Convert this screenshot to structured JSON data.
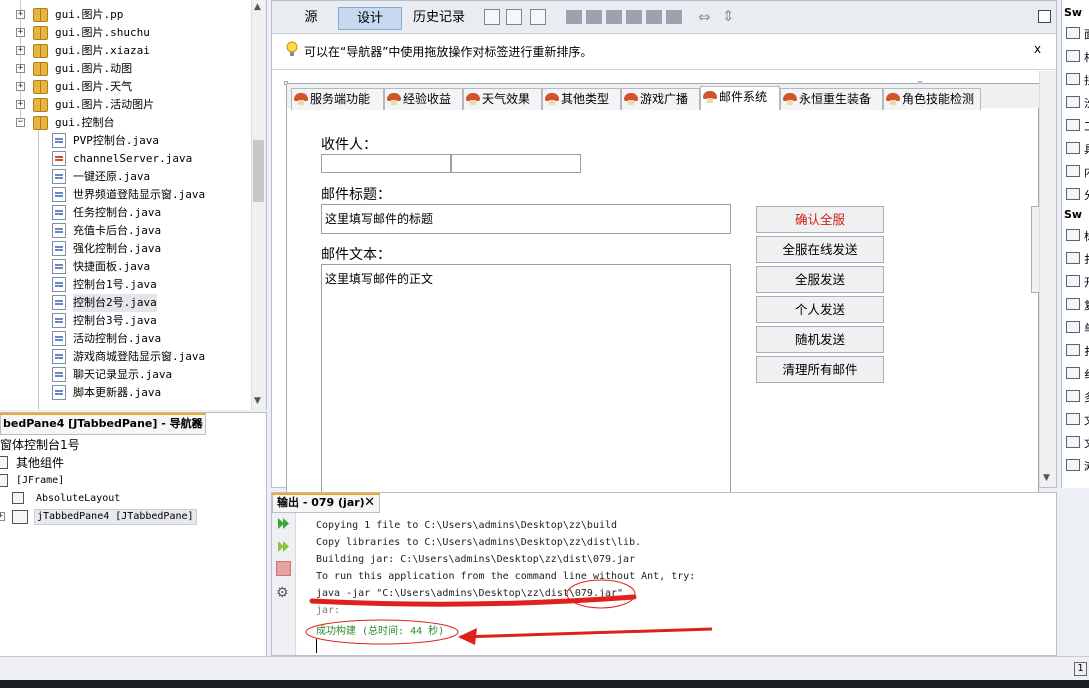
{
  "project_tree": {
    "items": [
      {
        "label": "gui.图片.pp",
        "kind": "package"
      },
      {
        "label": "gui.图片.shuchu",
        "kind": "package"
      },
      {
        "label": "gui.图片.xiazai",
        "kind": "package"
      },
      {
        "label": "gui.图片.动图",
        "kind": "package"
      },
      {
        "label": "gui.图片.天气",
        "kind": "package"
      },
      {
        "label": "gui.图片.活动图片",
        "kind": "package"
      },
      {
        "label": "gui.控制台",
        "kind": "package-open"
      },
      {
        "label": "PVP控制台.java",
        "kind": "java"
      },
      {
        "label": "channelServer.java",
        "kind": "java-red"
      },
      {
        "label": "一键还原.java",
        "kind": "java"
      },
      {
        "label": "世界频道登陆显示窗.java",
        "kind": "java"
      },
      {
        "label": "任务控制台.java",
        "kind": "java"
      },
      {
        "label": "充值卡后台.java",
        "kind": "java"
      },
      {
        "label": "强化控制台.java",
        "kind": "java"
      },
      {
        "label": "快捷面板.java",
        "kind": "java"
      },
      {
        "label": "控制台1号.java",
        "kind": "java"
      },
      {
        "label": "控制台2号.java",
        "kind": "java-selected"
      },
      {
        "label": "控制台3号.java",
        "kind": "java"
      },
      {
        "label": "活动控制台.java",
        "kind": "java"
      },
      {
        "label": "游戏商城登陆显示窗.java",
        "kind": "java"
      },
      {
        "label": "聊天记录显示.java",
        "kind": "java"
      },
      {
        "label": "脚本更新器.java",
        "kind": "java"
      }
    ]
  },
  "navigator": {
    "tab_label": "bedPane4 [JTabbedPane] - 导航器",
    "tab_close": "✕",
    "items": [
      {
        "label": "窗体控制台1号"
      },
      {
        "label": "其他组件"
      },
      {
        "label": "[JFrame]"
      },
      {
        "label": "AbsoluteLayout"
      },
      {
        "label": "jTabbedPane4 [JTabbedPane]"
      }
    ]
  },
  "editor": {
    "view_tabs": [
      "源",
      "设计",
      "历史记录"
    ],
    "active_view": "设计",
    "hint_text": "可以在“导航器”中使用拖放操作对标签进行重新排序。",
    "hint_close": "x",
    "tabs": [
      "服务端功能",
      "经验收益",
      "天气效果",
      "其他类型",
      "游戏广播",
      "邮件系统",
      "永恒重生装备",
      "角色技能检测"
    ],
    "active_tab": "邮件系统",
    "form": {
      "recipient_label": "收件人：",
      "title_label": "邮件标题：",
      "title_value": "这里填写邮件的标题",
      "body_label": "邮件文本：",
      "body_value": "这里填写邮件的正文"
    },
    "buttons": [
      {
        "label": "确认全服",
        "color": "#d0201a"
      },
      {
        "label": "全服在线发送",
        "color": "#000000"
      },
      {
        "label": "全服发送",
        "color": "#000000"
      },
      {
        "label": "个人发送",
        "color": "#000000"
      },
      {
        "label": "随机发送",
        "color": "#000000"
      },
      {
        "label": "清理所有邮件",
        "color": "#000000"
      }
    ]
  },
  "output": {
    "tab_label": "输出 - 079 (jar)",
    "tab_close": "✕",
    "lines": [
      {
        "text": "Copying 1 file to C:\\Users\\admins\\Desktop\\zz\\build",
        "style": "normal"
      },
      {
        "text": "Copy libraries to C:\\Users\\admins\\Desktop\\zz\\dist\\lib.",
        "style": "normal"
      },
      {
        "text": "Building jar: C:\\Users\\admins\\Desktop\\zz\\dist\\079.jar",
        "style": "normal"
      },
      {
        "text": "To run this application from the command line without Ant, try:",
        "style": "normal"
      },
      {
        "text": "java -jar \"C:\\Users\\admins\\Desktop\\zz\\dist\\079.jar\"",
        "style": "normal"
      },
      {
        "text": "jar:",
        "style": "gray"
      },
      {
        "text": "成功构建 (总时间: 44 秒)",
        "style": "green"
      }
    ],
    "annotation_color": "#e0211b"
  },
  "palette": {
    "section_1": "Sw",
    "section_2": "Sw",
    "chars": [
      "面",
      "村",
      "拐",
      "汾",
      "工",
      "具",
      "内",
      "分",
      "标",
      "扌",
      "开",
      "复",
      "单",
      "扌",
      "纟",
      "多",
      "文",
      "文",
      "滩",
      "进"
    ]
  },
  "status": {
    "notifications": "1"
  }
}
